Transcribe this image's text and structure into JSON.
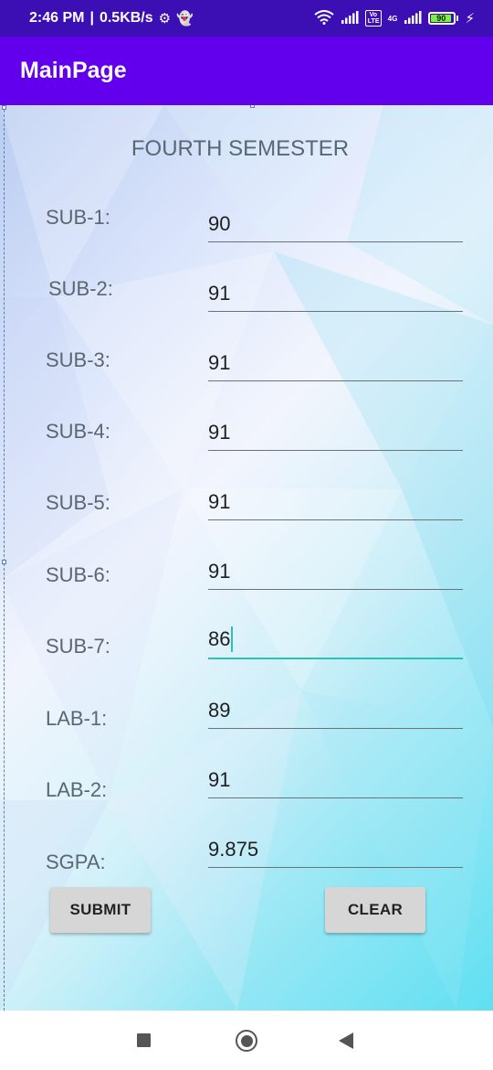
{
  "status_bar": {
    "time": "2:46 PM",
    "speed": "0.5KB/s",
    "network_label": "4G",
    "volte_label": "Vo LTE",
    "battery_level": "90",
    "battery_fraction": 0.9
  },
  "app_bar": {
    "title": "MainPage"
  },
  "heading": "FOURTH SEMESTER",
  "rows": [
    {
      "label": "SUB-1:",
      "value": "90"
    },
    {
      "label": "SUB-2:",
      "value": "91"
    },
    {
      "label": "SUB-3:",
      "value": "91"
    },
    {
      "label": "SUB-4:",
      "value": "91"
    },
    {
      "label": "SUB-5:",
      "value": "91"
    },
    {
      "label": "SUB-6:",
      "value": "91"
    },
    {
      "label": "SUB-7:",
      "value": "86"
    },
    {
      "label": "LAB-1:",
      "value": "89"
    },
    {
      "label": "LAB-2:",
      "value": "91"
    },
    {
      "label": "SGPA:",
      "value": "9.875"
    }
  ],
  "buttons": {
    "submit": "SUBMIT",
    "clear": "CLEAR"
  },
  "colors": {
    "status_bar": "#3b0fb4",
    "app_bar": "#6200ee",
    "focus_accent": "#2dc1b6"
  }
}
